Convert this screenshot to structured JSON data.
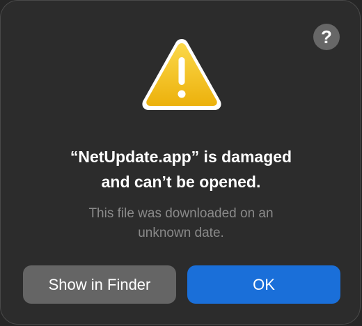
{
  "dialog": {
    "help_label": "?",
    "icon": "warning-triangle-icon",
    "title_line1": "“NetUpdate.app” is damaged",
    "title_line2": "and can’t be opened.",
    "message_line1": "This file was downloaded on an",
    "message_line2": "unknown date.",
    "secondary_button_label": "Show in Finder",
    "primary_button_label": "OK"
  },
  "colors": {
    "background": "#2c2c2c",
    "primary_button": "#1a6fd9",
    "secondary_button": "#656565",
    "warning_yellow": "#f2c20c"
  }
}
